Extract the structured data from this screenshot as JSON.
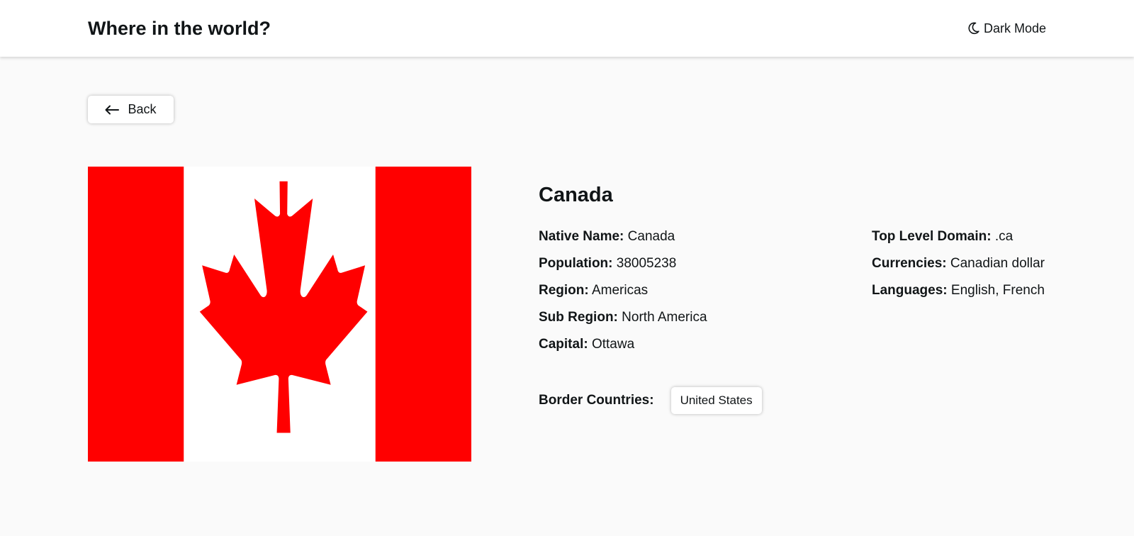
{
  "header": {
    "title": "Where in the world?",
    "theme_toggle_label": "Dark Mode",
    "theme_icon": "moon-icon"
  },
  "back_button": {
    "label": "Back",
    "icon": "arrow-left-icon"
  },
  "country": {
    "name": "Canada",
    "flag_icon": "canada-flag",
    "flag_colors": {
      "red": "#ff0000",
      "white": "#ffffff"
    },
    "details_left": [
      {
        "label": "Native Name:",
        "value": "Canada"
      },
      {
        "label": "Population:",
        "value": "38005238"
      },
      {
        "label": "Region:",
        "value": "Americas"
      },
      {
        "label": "Sub Region:",
        "value": "North America"
      },
      {
        "label": "Capital:",
        "value": "Ottawa"
      }
    ],
    "details_right": [
      {
        "label": "Top Level Domain:",
        "value": ".ca"
      },
      {
        "label": "Currencies:",
        "value": "Canadian dollar"
      },
      {
        "label": "Languages:",
        "value": "English, French"
      }
    ],
    "border_label": "Border Countries:",
    "border_countries": [
      "United States"
    ]
  },
  "colors": {
    "background": "#fafafa",
    "surface": "#ffffff",
    "text": "#111517"
  }
}
